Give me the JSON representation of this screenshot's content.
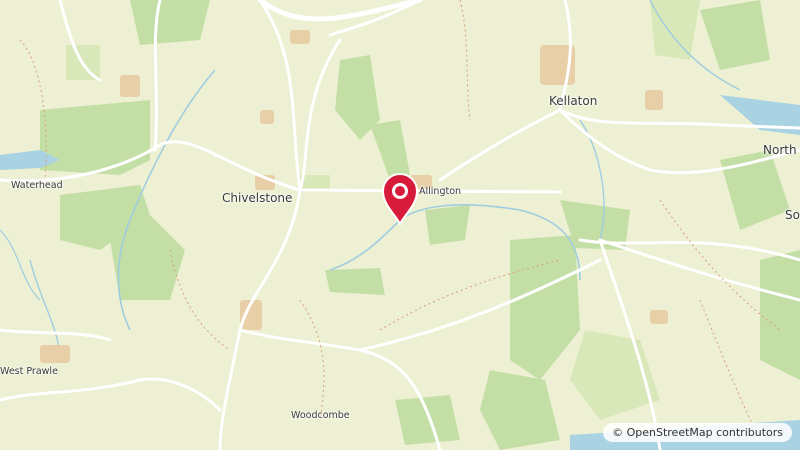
{
  "map": {
    "places": [
      {
        "id": "kellaton",
        "name": "Kellaton",
        "cls": "town"
      },
      {
        "id": "chivelstone",
        "name": "Chivelstone",
        "cls": "town"
      },
      {
        "id": "waterhead",
        "name": "Waterhead",
        "cls": "hamlet"
      },
      {
        "id": "allington",
        "name": "Allington",
        "cls": "hamlet"
      },
      {
        "id": "west-prawle",
        "name": "West Prawle",
        "cls": "hamlet"
      },
      {
        "id": "woodcombe",
        "name": "Woodcombe",
        "cls": "hamlet"
      },
      {
        "id": "north-partial",
        "name": "North",
        "cls": "town"
      },
      {
        "id": "so-partial",
        "name": "So",
        "cls": "town"
      }
    ],
    "marker_icon": "map-pin-icon",
    "attribution": {
      "symbol": "©",
      "text": "OpenStreetMap contributors"
    },
    "colors": {
      "land": "#eef0d3",
      "woodland": "#b5d9a0",
      "water": "#a9d2e3",
      "road": "#ffffff",
      "marker": "#d81b3a"
    }
  }
}
